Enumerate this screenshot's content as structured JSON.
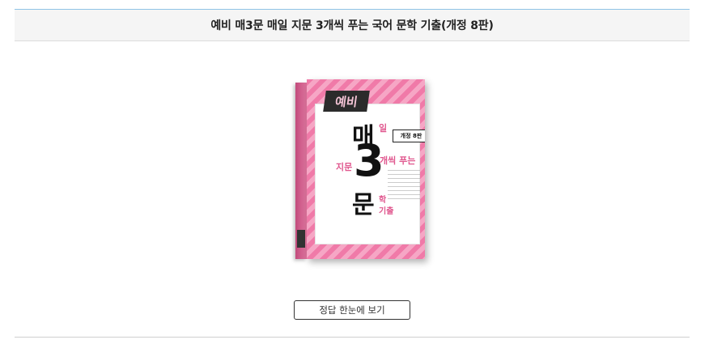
{
  "header": {
    "title": "예비 매3문 매일 지문 3개씩 푸는 국어 문학 기출(개정 8판)"
  },
  "book_cover": {
    "badge": "예비",
    "char_1": "매",
    "char_1_small": "일",
    "char_2": "3",
    "char_2_left": "지문",
    "char_2_right": "개씩 푸는",
    "char_3": "문",
    "char_3_small_1": "학",
    "char_3_small_2": "기출",
    "edition": "개정 8판",
    "colors": {
      "pink": "#f07aa8",
      "dark": "#2b2b2b",
      "accent": "#e0578e"
    }
  },
  "actions": {
    "answer_button_label": "정답 한눈에 보기"
  }
}
